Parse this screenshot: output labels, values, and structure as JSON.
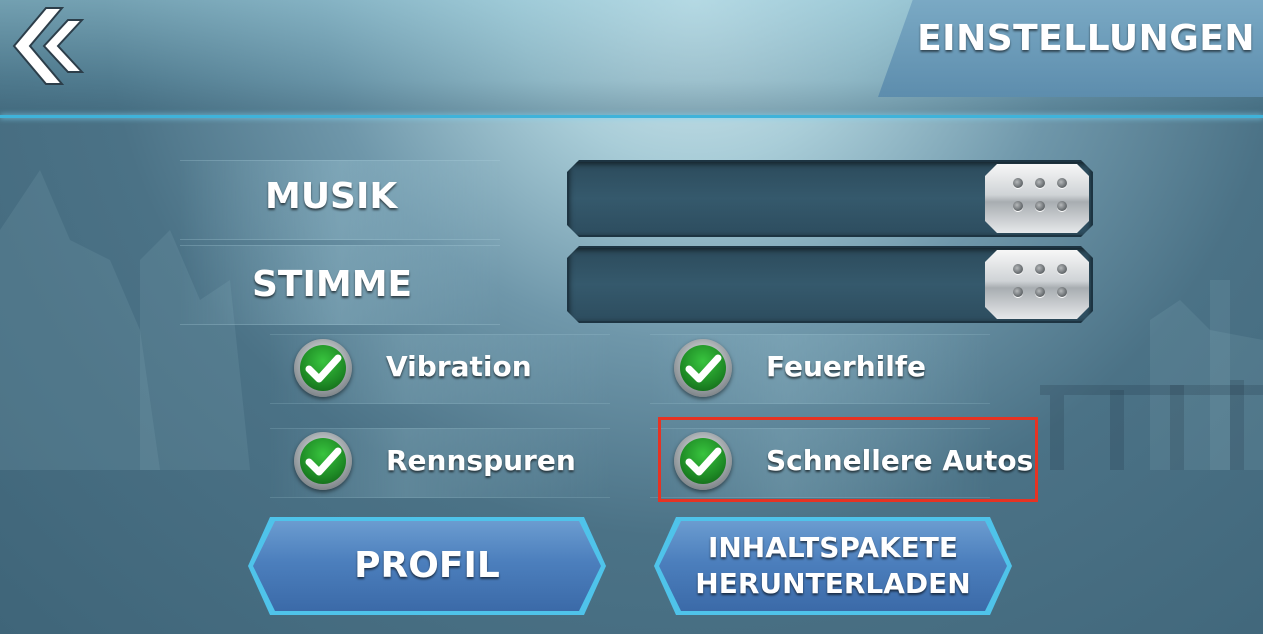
{
  "header": {
    "title": "EINSTELLUNGEN",
    "back_icon": "double-chevron-left-icon"
  },
  "sliders": [
    {
      "label": "MUSIK",
      "level_percent": 100
    },
    {
      "label": "STIMME",
      "level_percent": 100
    }
  ],
  "options": [
    {
      "label": "Vibration",
      "checked": true
    },
    {
      "label": "Feuerhilfe",
      "checked": true
    },
    {
      "label": "Rennspuren",
      "checked": true
    },
    {
      "label": "Schnellere Autos",
      "checked": true
    }
  ],
  "buttons": {
    "profile": "PROFIL",
    "download_line1": "INHALTSPAKETE",
    "download_line2": "HERUNTERLADEN"
  },
  "colors": {
    "accent": "#3fb3da",
    "highlight": "#e63323",
    "check_green": "#2bb532"
  }
}
